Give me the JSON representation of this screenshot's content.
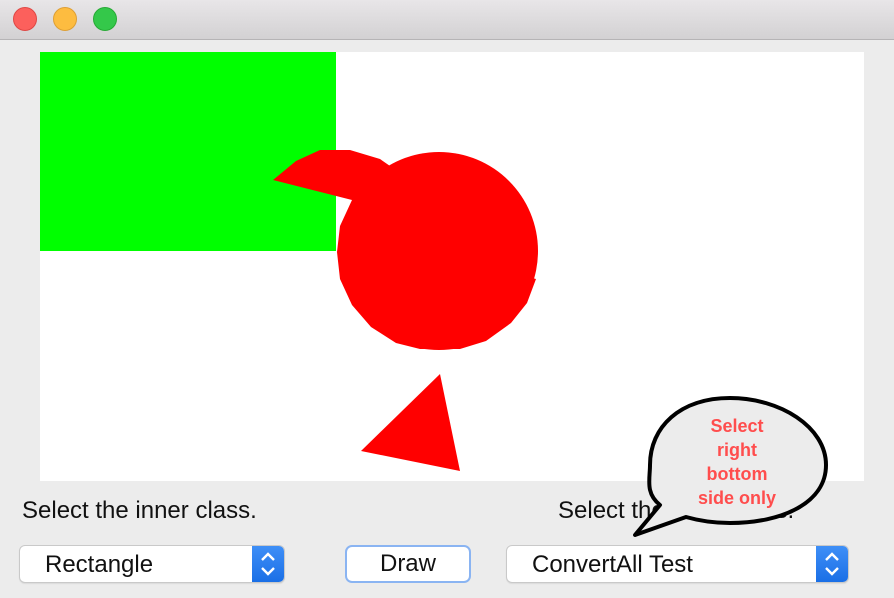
{
  "window": {
    "controls": [
      "close",
      "minimize",
      "maximize"
    ]
  },
  "canvas": {
    "shapes": [
      {
        "type": "rectangle",
        "color": "#00ff00"
      },
      {
        "type": "circle",
        "color": "#ff0000"
      },
      {
        "type": "triangle",
        "color": "#ff0000"
      }
    ]
  },
  "controls": {
    "left_label": "Select the inner class.",
    "right_label": "Select the outer class.",
    "left_select_value": "Rectangle",
    "draw_button": "Draw",
    "right_select_value": "ConvertAll Test"
  },
  "annotation": {
    "text_lines": [
      "Select",
      "right",
      "bottom",
      "side only"
    ],
    "color": "#ff4d4d"
  }
}
